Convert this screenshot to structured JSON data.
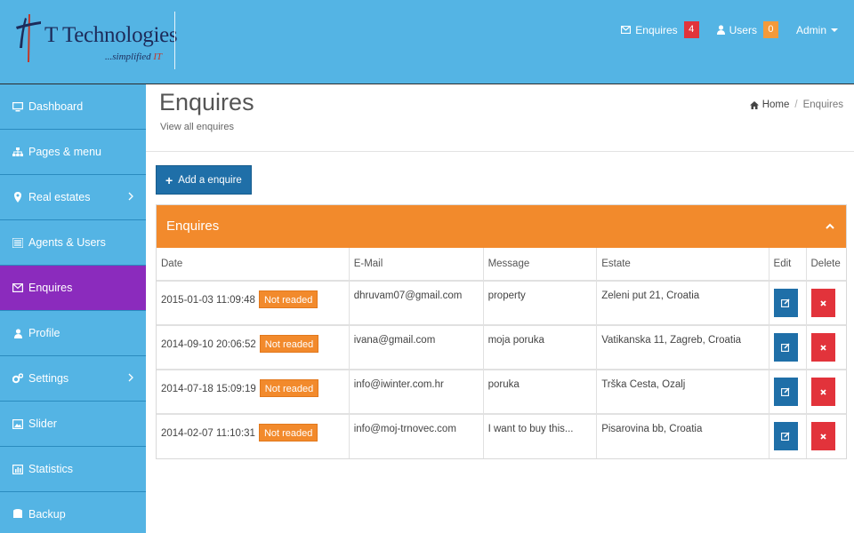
{
  "header": {
    "logo": {
      "title": "T Technologies",
      "tagline_prefix": "...simplified ",
      "tagline_brand": "IT"
    },
    "nav": [
      {
        "label": "Enquires",
        "badge": "4",
        "icon": "envelope-icon",
        "badge_color": "#e2333b"
      },
      {
        "label": "Users",
        "badge": "0",
        "icon": "user-icon",
        "badge_color": "#f39a3a"
      }
    ],
    "admin_label": "Admin"
  },
  "sidebar": {
    "items": [
      {
        "label": "Dashboard",
        "icon": "monitor-icon",
        "active": false,
        "has_children": false
      },
      {
        "label": "Pages & menu",
        "icon": "sitemap-icon",
        "active": false,
        "has_children": false
      },
      {
        "label": "Real estates",
        "icon": "map-marker-icon",
        "active": false,
        "has_children": true
      },
      {
        "label": "Agents & Users",
        "icon": "list-icon",
        "active": false,
        "has_children": false
      },
      {
        "label": "Enquires",
        "icon": "envelope-icon",
        "active": true,
        "has_children": false
      },
      {
        "label": "Profile",
        "icon": "user-icon",
        "active": false,
        "has_children": false
      },
      {
        "label": "Settings",
        "icon": "gears-icon",
        "active": false,
        "has_children": true
      },
      {
        "label": "Slider",
        "icon": "picture-icon",
        "active": false,
        "has_children": false
      },
      {
        "label": "Statistics",
        "icon": "bar-chart-icon",
        "active": false,
        "has_children": false
      },
      {
        "label": "Backup",
        "icon": "database-icon",
        "active": false,
        "has_children": false
      }
    ]
  },
  "page": {
    "title": "Enquires",
    "subtitle": "View all enquires",
    "breadcrumb": {
      "home": "Home",
      "current": "Enquires"
    },
    "add_button": "Add a enquire"
  },
  "panel": {
    "title": "Enquires",
    "columns": [
      "Date",
      "E-Mail",
      "Message",
      "Estate",
      "Edit",
      "Delete"
    ],
    "rows": [
      {
        "date": "2015-01-03 11:09:48",
        "status": "Not readed",
        "email": "dhruvam07@gmail.com",
        "message": "property",
        "estate": "Zeleni put 21, Croatia"
      },
      {
        "date": "2014-09-10 20:06:52",
        "status": "Not readed",
        "email": "ivana@gmail.com",
        "message": "moja poruka",
        "estate": "Vatikanska 11, Zagreb, Croatia"
      },
      {
        "date": "2014-07-18 15:09:19",
        "status": "Not readed",
        "email": "info@iwinter.com.hr",
        "message": "poruka",
        "estate": "Trška Cesta, Ozalj"
      },
      {
        "date": "2014-02-07 11:10:31",
        "status": "Not readed",
        "email": "info@moj-trnovec.com",
        "message": "I want to buy this...",
        "estate": "Pisarovina bb, Croatia"
      }
    ]
  },
  "colors": {
    "header_bg": "#54b4e4",
    "active_item": "#8b2bbd",
    "panel_header": "#f28a2c",
    "primary_button": "#1f6fa8",
    "danger_button": "#e2333b"
  }
}
